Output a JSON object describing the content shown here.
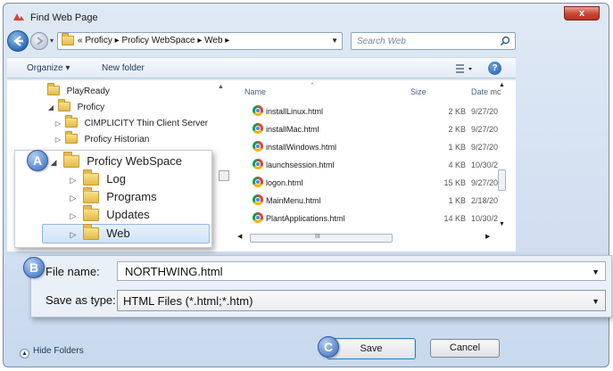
{
  "window": {
    "title": "Find Web Page",
    "close_label": "x"
  },
  "address": {
    "crumbs": "« Proficy  ▸  Proficy WebSpace  ▸  Web  ▸",
    "search_placeholder": "Search Web"
  },
  "toolbar": {
    "organize_label": "Organize ▾",
    "new_folder_label": "New folder",
    "help_label": "?"
  },
  "nav_tree": [
    {
      "label": "PlayReady",
      "expander": ""
    },
    {
      "label": "Proficy",
      "expander": "◢"
    },
    {
      "label": "CIMPLICITY Thin Client Server",
      "expander": "▷"
    },
    {
      "label": "Proficy Historian",
      "expander": "▷"
    }
  ],
  "zoom_tree": [
    {
      "label": "Proficy WebSpace",
      "expander": "◢"
    },
    {
      "label": "Log",
      "expander": "▷"
    },
    {
      "label": "Programs",
      "expander": "▷"
    },
    {
      "label": "Updates",
      "expander": "▷"
    },
    {
      "label": "Web",
      "expander": "▷"
    }
  ],
  "file_columns": {
    "name": "Name",
    "size": "Size",
    "date": "Date mc"
  },
  "files": [
    {
      "name": "installLinux.html",
      "size": "2 KB",
      "date": "9/27/20"
    },
    {
      "name": "installMac.html",
      "size": "2 KB",
      "date": "9/27/20"
    },
    {
      "name": "installWindows.html",
      "size": "1 KB",
      "date": "9/27/20"
    },
    {
      "name": "launchsession.html",
      "size": "4 KB",
      "date": "10/30/2"
    },
    {
      "name": "logon.html",
      "size": "15 KB",
      "date": "9/27/20"
    },
    {
      "name": "MainMenu.html",
      "size": "1 KB",
      "date": "2/18/20"
    },
    {
      "name": "PlantApplications.html",
      "size": "14 KB",
      "date": "10/30/2"
    }
  ],
  "form": {
    "file_name_label": "File name:",
    "file_name_value": "NORTHWING.html",
    "save_type_label": "Save as type:",
    "save_type_value": "HTML Files (*.html;*.htm)"
  },
  "footer": {
    "hide_folders_label": "Hide Folders",
    "save_label": "Save",
    "cancel_label": "Cancel"
  },
  "callouts": {
    "a": "A",
    "b": "B",
    "c": "C"
  },
  "scroll_thumb_label": "III",
  "colors": {
    "accent": "#5a87cf",
    "title_bar": "#c9d9ee",
    "close": "#c74432"
  }
}
